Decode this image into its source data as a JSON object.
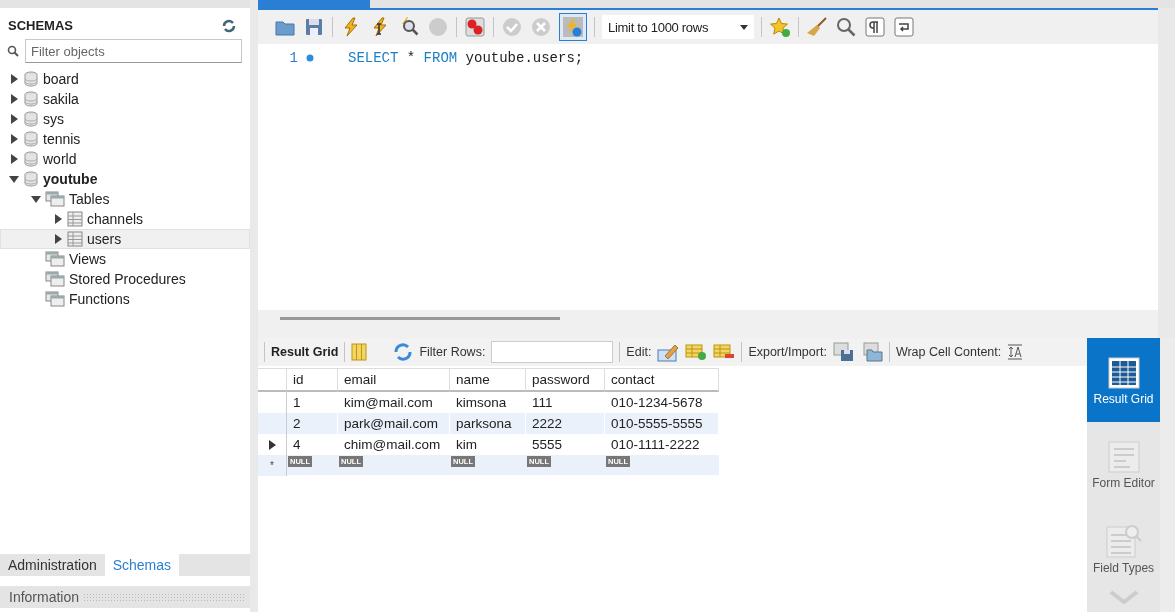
{
  "navigator": {
    "heading": "SCHEMAS",
    "filter": {
      "placeholder": "Filter objects"
    },
    "tree": [
      {
        "label": "board",
        "kind": "schema",
        "expanded": false,
        "selected": false,
        "default": false
      },
      {
        "label": "sakila",
        "kind": "schema",
        "expanded": false,
        "selected": false,
        "default": false
      },
      {
        "label": "sys",
        "kind": "schema",
        "expanded": false,
        "selected": false,
        "default": false
      },
      {
        "label": "tennis",
        "kind": "schema",
        "expanded": false,
        "selected": false,
        "default": false
      },
      {
        "label": "world",
        "kind": "schema",
        "expanded": false,
        "selected": false,
        "default": false
      },
      {
        "label": "youtube",
        "kind": "schema",
        "expanded": true,
        "selected": false,
        "default": true,
        "children": [
          {
            "label": "Tables",
            "kind": "folder",
            "expanded": true,
            "selected": false,
            "default": false,
            "children": [
              {
                "label": "channels",
                "kind": "table",
                "expanded": false,
                "selected": false,
                "default": false
              },
              {
                "label": "users",
                "kind": "table",
                "expanded": false,
                "selected": true,
                "default": false
              }
            ]
          },
          {
            "label": "Views",
            "kind": "folder",
            "selected": false,
            "default": false
          },
          {
            "label": "Stored Procedures",
            "kind": "folder",
            "selected": false,
            "default": false
          },
          {
            "label": "Functions",
            "kind": "folder",
            "selected": false,
            "default": false
          }
        ]
      }
    ],
    "tabs": [
      {
        "label": "Administration",
        "selected": false
      },
      {
        "label": "Schemas",
        "selected": true
      }
    ],
    "info_heading": "Information"
  },
  "editor_toolbar": {
    "auto_commit": true,
    "limit": "Limit to 1000 rows"
  },
  "editor": {
    "lines": [
      {
        "number": "1",
        "tokens": [
          {
            "text": "SELECT",
            "kind": "keyword"
          },
          {
            "text": "*",
            "kind": "plain"
          },
          {
            "text": "FROM",
            "kind": "keyword"
          },
          {
            "text": "youtube.users;",
            "kind": "plain"
          }
        ]
      }
    ]
  },
  "result_toolbar": {
    "title": "Result Grid",
    "filter_label": "Filter Rows:",
    "edit_label": "Edit:",
    "export_label": "Export/Import:",
    "wrap_label": "Wrap Cell Content:"
  },
  "grid": {
    "columns": [
      "id",
      "email",
      "name",
      "password",
      "contact"
    ],
    "rows": [
      {
        "current": false,
        "cells": [
          "1",
          "kim@mail.com",
          "kimsona",
          "111",
          "010-1234-5678"
        ]
      },
      {
        "current": false,
        "cells": [
          "2",
          "park@mail.com",
          "parksona",
          "2222",
          "010-5555-5555"
        ]
      },
      {
        "current": true,
        "cells": [
          "4",
          "chim@mail.com",
          "kim",
          "5555",
          "010-1111-2222"
        ]
      }
    ],
    "new_row": {
      "marker": "*",
      "cells": [
        "NULL",
        "NULL",
        "NULL",
        "NULL",
        "NULL"
      ]
    }
  },
  "side_panel": [
    {
      "label": "Result Grid",
      "selected": true
    },
    {
      "label": "Form Editor",
      "selected": false
    },
    {
      "label": "Field Types",
      "selected": false
    }
  ]
}
